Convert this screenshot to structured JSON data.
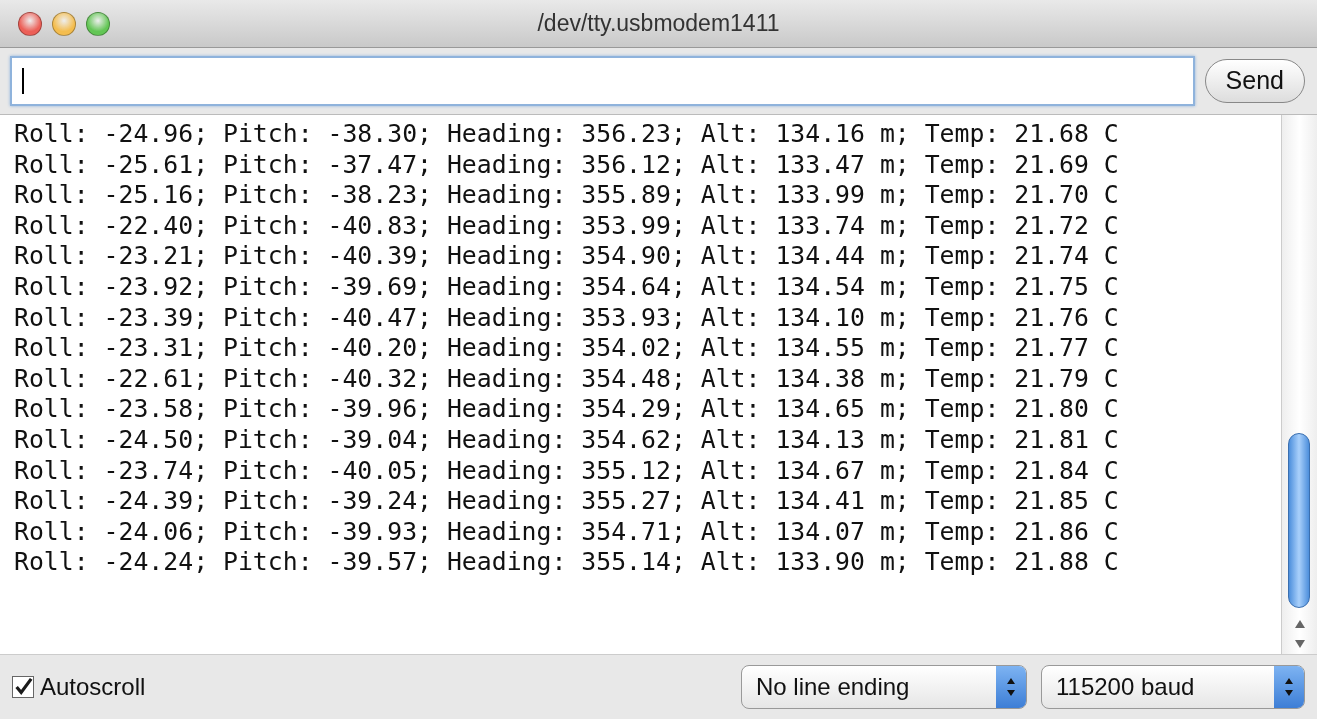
{
  "window": {
    "title": "/dev/tty.usbmodem1411"
  },
  "send_button": {
    "label": "Send"
  },
  "output_lines": [
    "Roll: -24.96; Pitch: -38.30; Heading: 356.23; Alt: 134.16 m; Temp: 21.68 C",
    "Roll: -25.61; Pitch: -37.47; Heading: 356.12; Alt: 133.47 m; Temp: 21.69 C",
    "Roll: -25.16; Pitch: -38.23; Heading: 355.89; Alt: 133.99 m; Temp: 21.70 C",
    "Roll: -22.40; Pitch: -40.83; Heading: 353.99; Alt: 133.74 m; Temp: 21.72 C",
    "Roll: -23.21; Pitch: -40.39; Heading: 354.90; Alt: 134.44 m; Temp: 21.74 C",
    "Roll: -23.92; Pitch: -39.69; Heading: 354.64; Alt: 134.54 m; Temp: 21.75 C",
    "Roll: -23.39; Pitch: -40.47; Heading: 353.93; Alt: 134.10 m; Temp: 21.76 C",
    "Roll: -23.31; Pitch: -40.20; Heading: 354.02; Alt: 134.55 m; Temp: 21.77 C",
    "Roll: -22.61; Pitch: -40.32; Heading: 354.48; Alt: 134.38 m; Temp: 21.79 C",
    "Roll: -23.58; Pitch: -39.96; Heading: 354.29; Alt: 134.65 m; Temp: 21.80 C",
    "Roll: -24.50; Pitch: -39.04; Heading: 354.62; Alt: 134.13 m; Temp: 21.81 C",
    "Roll: -23.74; Pitch: -40.05; Heading: 355.12; Alt: 134.67 m; Temp: 21.84 C",
    "Roll: -24.39; Pitch: -39.24; Heading: 355.27; Alt: 134.41 m; Temp: 21.85 C",
    "Roll: -24.06; Pitch: -39.93; Heading: 354.71; Alt: 134.07 m; Temp: 21.86 C",
    "Roll: -24.24; Pitch: -39.57; Heading: 355.14; Alt: 133.90 m; Temp: 21.88 C"
  ],
  "autoscroll": {
    "label": "Autoscroll",
    "checked": true
  },
  "line_ending": {
    "value": "No line ending"
  },
  "baud_rate": {
    "value": "115200 baud"
  }
}
